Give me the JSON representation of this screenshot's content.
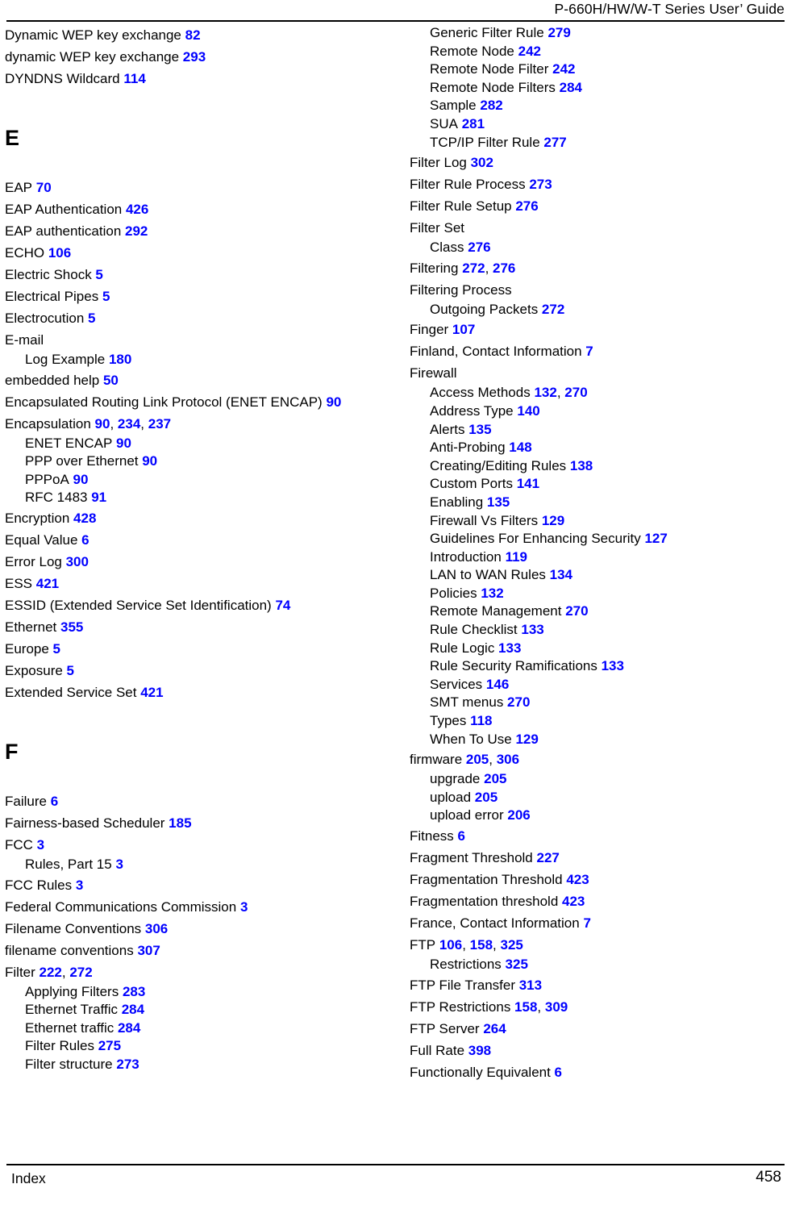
{
  "header": {
    "title": "P-660H/HW/W-T Series User’ Guide"
  },
  "footer": {
    "label": "Index",
    "page_number": "458"
  },
  "accent_color": "#0000ff",
  "columns": [
    {
      "name": "left-column",
      "blocks": [
        {
          "type": "entries",
          "items": [
            {
              "level": 0,
              "text": "Dynamic WEP key exchange",
              "pages": [
                "82"
              ]
            },
            {
              "level": 0,
              "text": "dynamic WEP key exchange",
              "pages": [
                "293"
              ]
            },
            {
              "level": 0,
              "text": "DYNDNS Wildcard",
              "pages": [
                "114"
              ]
            }
          ]
        },
        {
          "type": "letter",
          "letter": "E"
        },
        {
          "type": "entries",
          "items": [
            {
              "level": 0,
              "text": "EAP",
              "pages": [
                "70"
              ]
            },
            {
              "level": 0,
              "text": "EAP Authentication",
              "pages": [
                "426"
              ]
            },
            {
              "level": 0,
              "text": "EAP authentication",
              "pages": [
                "292"
              ]
            },
            {
              "level": 0,
              "text": "ECHO",
              "pages": [
                "106"
              ]
            },
            {
              "level": 0,
              "text": "Electric Shock",
              "pages": [
                "5"
              ]
            },
            {
              "level": 0,
              "text": "Electrical Pipes",
              "pages": [
                "5"
              ]
            },
            {
              "level": 0,
              "text": "Electrocution",
              "pages": [
                "5"
              ]
            },
            {
              "level": 0,
              "text": "E-mail",
              "pages": []
            },
            {
              "level": 1,
              "text": "Log Example",
              "pages": [
                "180"
              ]
            },
            {
              "level": 0,
              "text": "embedded help",
              "pages": [
                "50"
              ]
            },
            {
              "level": 0,
              "text": "Encapsulated Routing Link Protocol (ENET ENCAP)",
              "pages": [
                "90"
              ]
            },
            {
              "level": 0,
              "text": "Encapsulation",
              "pages": [
                "90",
                "234",
                "237"
              ]
            },
            {
              "level": 1,
              "text": "ENET ENCAP",
              "pages": [
                "90"
              ]
            },
            {
              "level": 1,
              "text": "PPP over Ethernet",
              "pages": [
                "90"
              ]
            },
            {
              "level": 1,
              "text": "PPPoA",
              "pages": [
                "90"
              ]
            },
            {
              "level": 1,
              "text": "RFC 1483",
              "pages": [
                "91"
              ]
            },
            {
              "level": 0,
              "text": "Encryption",
              "pages": [
                "428"
              ]
            },
            {
              "level": 0,
              "text": "Equal Value",
              "pages": [
                "6"
              ]
            },
            {
              "level": 0,
              "text": "Error Log",
              "pages": [
                "300"
              ]
            },
            {
              "level": 0,
              "text": "ESS",
              "pages": [
                "421"
              ]
            },
            {
              "level": 0,
              "text": "ESSID (Extended Service Set Identification)",
              "pages": [
                "74"
              ]
            },
            {
              "level": 0,
              "text": "Ethernet",
              "pages": [
                "355"
              ]
            },
            {
              "level": 0,
              "text": "Europe",
              "pages": [
                "5"
              ]
            },
            {
              "level": 0,
              "text": "Exposure",
              "pages": [
                "5"
              ]
            },
            {
              "level": 0,
              "text": "Extended Service Set",
              "pages": [
                "421"
              ]
            }
          ]
        },
        {
          "type": "letter",
          "letter": "F"
        },
        {
          "type": "entries",
          "items": [
            {
              "level": 0,
              "text": "Failure",
              "pages": [
                "6"
              ]
            },
            {
              "level": 0,
              "text": "Fairness-based Scheduler",
              "pages": [
                "185"
              ]
            },
            {
              "level": 0,
              "text": "FCC",
              "pages": [
                "3"
              ]
            },
            {
              "level": 1,
              "text": "Rules, Part 15",
              "pages": [
                "3"
              ]
            },
            {
              "level": 0,
              "text": "FCC Rules",
              "pages": [
                "3"
              ]
            },
            {
              "level": 0,
              "text": "Federal Communications Commission",
              "pages": [
                "3"
              ]
            },
            {
              "level": 0,
              "text": "Filename Conventions",
              "pages": [
                "306"
              ]
            },
            {
              "level": 0,
              "text": "filename conventions",
              "pages": [
                "307"
              ]
            },
            {
              "level": 0,
              "text": "Filter",
              "pages": [
                "222",
                "272"
              ]
            },
            {
              "level": 1,
              "text": "Applying Filters",
              "pages": [
                "283"
              ]
            },
            {
              "level": 1,
              "text": "Ethernet Traffic",
              "pages": [
                "284"
              ]
            },
            {
              "level": 1,
              "text": "Ethernet traffic",
              "pages": [
                "284"
              ]
            },
            {
              "level": 1,
              "text": "Filter Rules",
              "pages": [
                "275"
              ]
            },
            {
              "level": 1,
              "text": "Filter structure",
              "pages": [
                "273"
              ]
            }
          ]
        }
      ]
    },
    {
      "name": "right-column",
      "blocks": [
        {
          "type": "entries",
          "items": [
            {
              "level": 1,
              "text": "Generic Filter Rule",
              "pages": [
                "279"
              ]
            },
            {
              "level": 1,
              "text": "Remote Node",
              "pages": [
                "242"
              ]
            },
            {
              "level": 1,
              "text": "Remote Node Filter",
              "pages": [
                "242"
              ]
            },
            {
              "level": 1,
              "text": "Remote Node Filters",
              "pages": [
                "284"
              ]
            },
            {
              "level": 1,
              "text": "Sample",
              "pages": [
                "282"
              ]
            },
            {
              "level": 1,
              "text": "SUA",
              "pages": [
                "281"
              ]
            },
            {
              "level": 1,
              "text": "TCP/IP Filter Rule",
              "pages": [
                "277"
              ]
            },
            {
              "level": 0,
              "text": "Filter Log",
              "pages": [
                "302"
              ]
            },
            {
              "level": 0,
              "text": "Filter Rule Process",
              "pages": [
                "273"
              ]
            },
            {
              "level": 0,
              "text": "Filter Rule Setup",
              "pages": [
                "276"
              ]
            },
            {
              "level": 0,
              "text": "Filter Set",
              "pages": []
            },
            {
              "level": 1,
              "text": "Class",
              "pages": [
                "276"
              ]
            },
            {
              "level": 0,
              "text": "Filtering",
              "pages": [
                "272",
                "276"
              ]
            },
            {
              "level": 0,
              "text": "Filtering Process",
              "pages": []
            },
            {
              "level": 1,
              "text": "Outgoing Packets",
              "pages": [
                "272"
              ]
            },
            {
              "level": 0,
              "text": "Finger",
              "pages": [
                "107"
              ]
            },
            {
              "level": 0,
              "text": "Finland, Contact Information",
              "pages": [
                "7"
              ]
            },
            {
              "level": 0,
              "text": "Firewall",
              "pages": []
            },
            {
              "level": 1,
              "text": "Access Methods",
              "pages": [
                "132",
                "270"
              ]
            },
            {
              "level": 1,
              "text": "Address Type",
              "pages": [
                "140"
              ]
            },
            {
              "level": 1,
              "text": "Alerts",
              "pages": [
                "135"
              ]
            },
            {
              "level": 1,
              "text": "Anti-Probing",
              "pages": [
                "148"
              ]
            },
            {
              "level": 1,
              "text": "Creating/Editing Rules",
              "pages": [
                "138"
              ]
            },
            {
              "level": 1,
              "text": "Custom Ports",
              "pages": [
                "141"
              ]
            },
            {
              "level": 1,
              "text": "Enabling",
              "pages": [
                "135"
              ]
            },
            {
              "level": 1,
              "text": "Firewall Vs Filters",
              "pages": [
                "129"
              ]
            },
            {
              "level": 1,
              "text": "Guidelines For Enhancing Security",
              "pages": [
                "127"
              ]
            },
            {
              "level": 1,
              "text": "Introduction",
              "pages": [
                "119"
              ]
            },
            {
              "level": 1,
              "text": "LAN to WAN Rules",
              "pages": [
                "134"
              ]
            },
            {
              "level": 1,
              "text": "Policies",
              "pages": [
                "132"
              ]
            },
            {
              "level": 1,
              "text": "Remote Management",
              "pages": [
                "270"
              ]
            },
            {
              "level": 1,
              "text": "Rule Checklist",
              "pages": [
                "133"
              ]
            },
            {
              "level": 1,
              "text": "Rule Logic",
              "pages": [
                "133"
              ]
            },
            {
              "level": 1,
              "text": "Rule Security Ramifications",
              "pages": [
                "133"
              ]
            },
            {
              "level": 1,
              "text": "Services",
              "pages": [
                "146"
              ]
            },
            {
              "level": 1,
              "text": "SMT menus",
              "pages": [
                "270"
              ]
            },
            {
              "level": 1,
              "text": "Types",
              "pages": [
                "118"
              ]
            },
            {
              "level": 1,
              "text": "When To Use",
              "pages": [
                "129"
              ]
            },
            {
              "level": 0,
              "text": "firmware",
              "pages": [
                "205",
                "306"
              ]
            },
            {
              "level": 1,
              "text": "upgrade",
              "pages": [
                "205"
              ]
            },
            {
              "level": 1,
              "text": "upload",
              "pages": [
                "205"
              ]
            },
            {
              "level": 1,
              "text": "upload error",
              "pages": [
                "206"
              ]
            },
            {
              "level": 0,
              "text": "Fitness",
              "pages": [
                "6"
              ]
            },
            {
              "level": 0,
              "text": "Fragment Threshold",
              "pages": [
                "227"
              ]
            },
            {
              "level": 0,
              "text": "Fragmentation Threshold",
              "pages": [
                "423"
              ]
            },
            {
              "level": 0,
              "text": "Fragmentation threshold",
              "pages": [
                "423"
              ]
            },
            {
              "level": 0,
              "text": "France, Contact Information",
              "pages": [
                "7"
              ]
            },
            {
              "level": 0,
              "text": "FTP",
              "pages": [
                "106",
                "158",
                "325"
              ]
            },
            {
              "level": 1,
              "text": "Restrictions",
              "pages": [
                "325"
              ]
            },
            {
              "level": 0,
              "text": "FTP File Transfer",
              "pages": [
                "313"
              ]
            },
            {
              "level": 0,
              "text": "FTP Restrictions",
              "pages": [
                "158",
                "309"
              ]
            },
            {
              "level": 0,
              "text": "FTP Server",
              "pages": [
                "264"
              ]
            },
            {
              "level": 0,
              "text": "Full Rate",
              "pages": [
                "398"
              ]
            },
            {
              "level": 0,
              "text": "Functionally Equivalent",
              "pages": [
                "6"
              ]
            }
          ]
        }
      ]
    }
  ]
}
